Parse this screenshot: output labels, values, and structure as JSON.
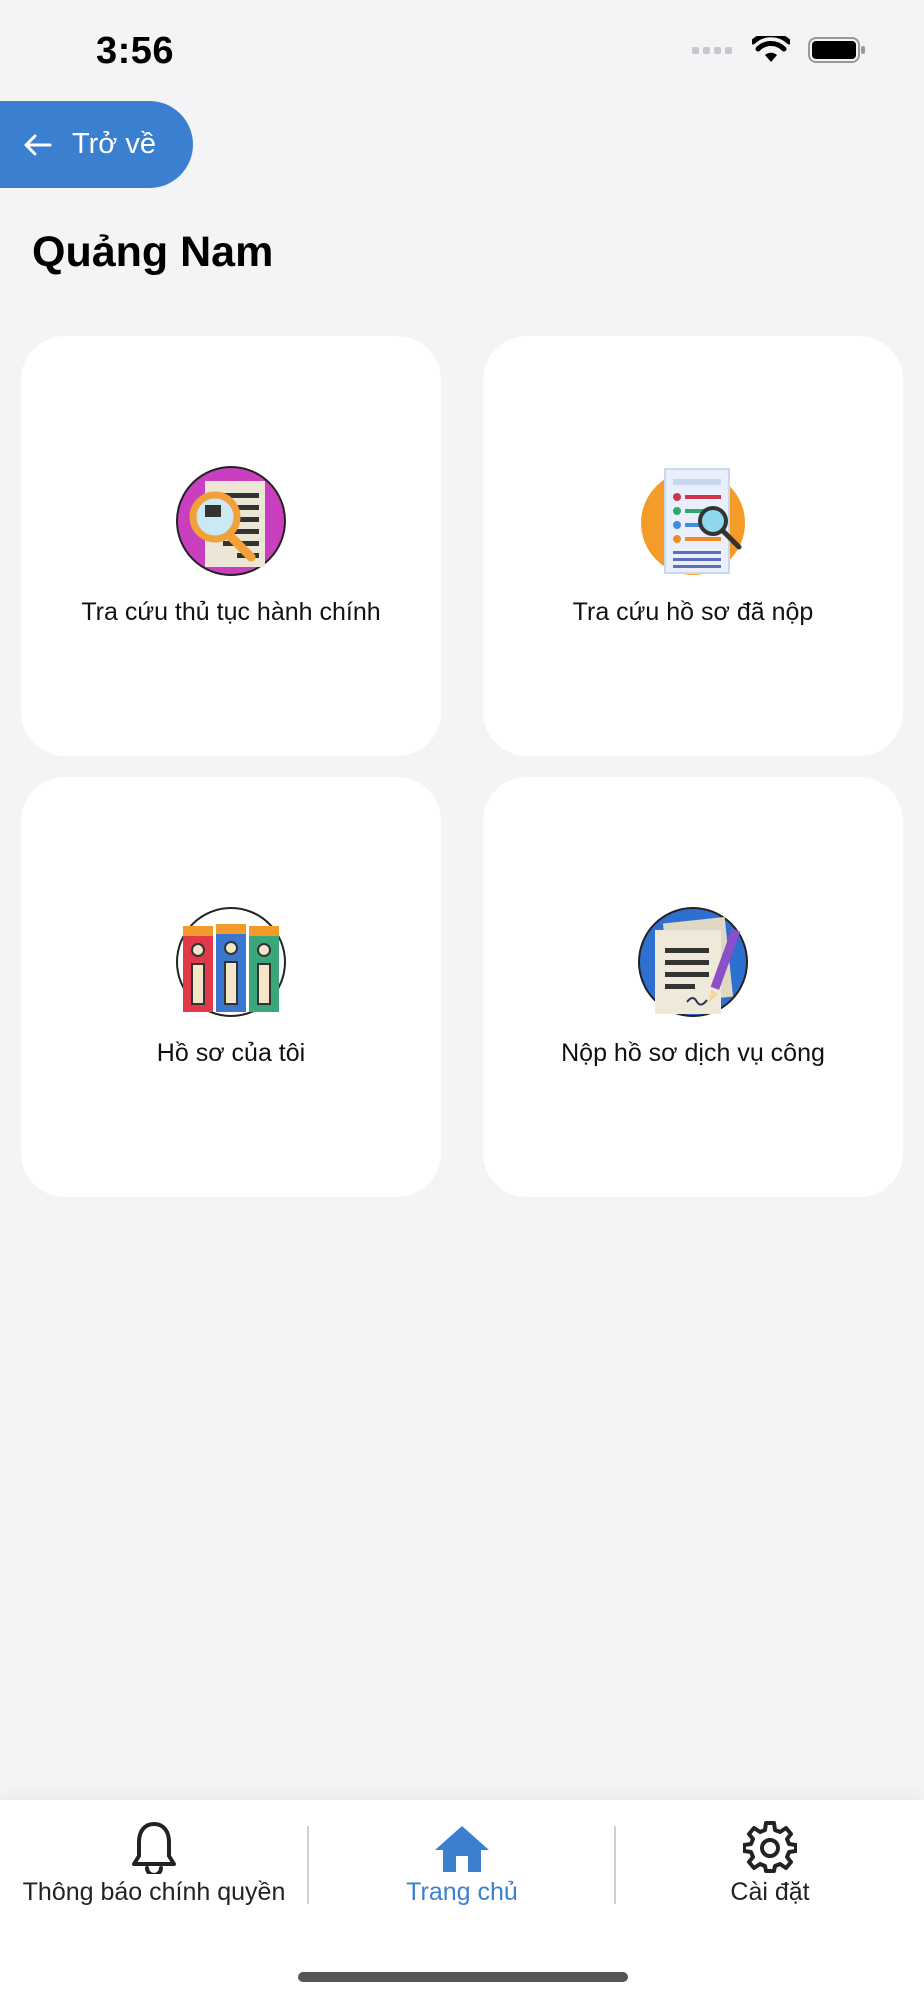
{
  "status_bar": {
    "time": "3:56",
    "icons": [
      "signal-icon",
      "wifi-icon",
      "battery-icon"
    ]
  },
  "header": {
    "back_label": "Trở về",
    "title": "Quảng Nam"
  },
  "cards": [
    {
      "label": "Tra cứu thủ tục hành chính",
      "icon": "search-procedure-icon"
    },
    {
      "label": "Tra cứu hồ sơ đã nộp",
      "icon": "search-submitted-icon"
    },
    {
      "label": "Hồ sơ của tôi",
      "icon": "my-files-icon"
    },
    {
      "label": "Nộp hồ sơ dịch vụ công",
      "icon": "submit-service-icon"
    }
  ],
  "bottom_nav": {
    "items": [
      {
        "label": "Thông báo chính quyền",
        "icon": "bell-icon",
        "active": false
      },
      {
        "label": "Trang chủ",
        "icon": "home-icon",
        "active": true
      },
      {
        "label": "Cài đặt",
        "icon": "gear-icon",
        "active": false
      }
    ]
  },
  "colors": {
    "accent": "#3a7fd0",
    "background": "#f4f4f6",
    "card": "#ffffff"
  }
}
